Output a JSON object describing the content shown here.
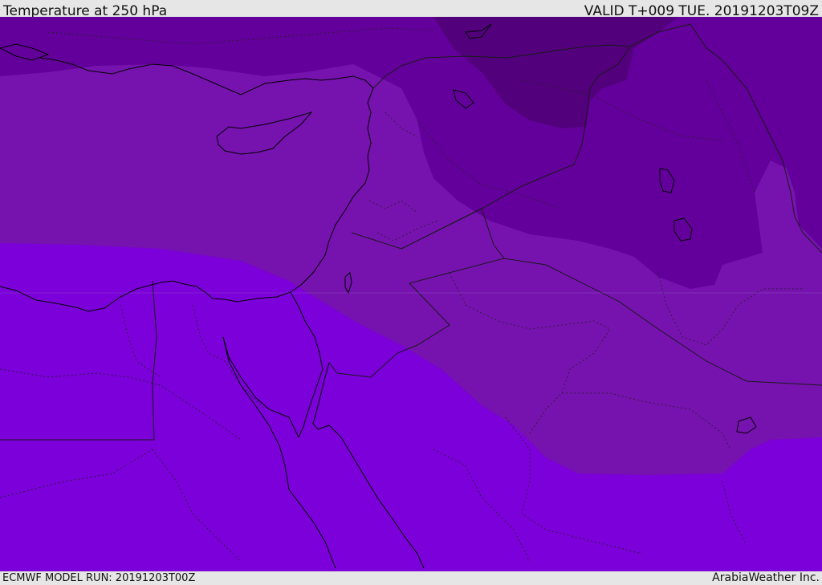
{
  "header": {
    "title": "Temperature at 250 hPa",
    "valid": "VALID T+009 TUE. 20191203T09Z"
  },
  "footer": {
    "model_run": "ECMWF MODEL RUN: 20191203T00Z",
    "credit": "ArabiaWeather Inc."
  },
  "map": {
    "colors": {
      "warmest_band": "#7b00d9",
      "mid_band": "#7612ae",
      "cool_band": "#63009b",
      "coldest_band": "#52007c",
      "coastline": "#000000",
      "border": "#1a1a1a"
    }
  }
}
